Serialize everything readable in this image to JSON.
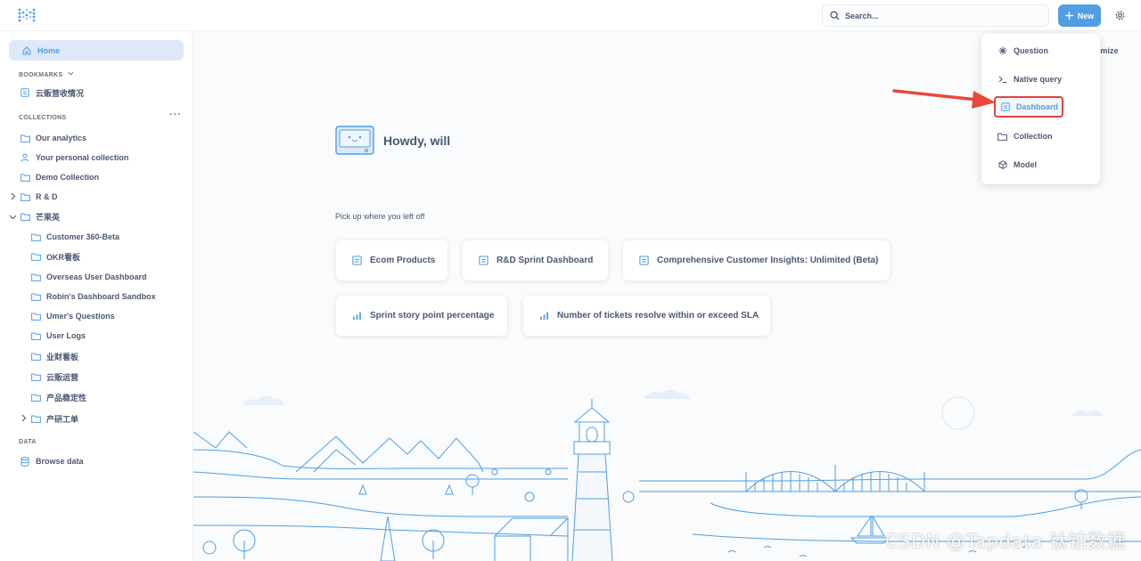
{
  "header": {
    "search_placeholder": "Search...",
    "new_label": "New"
  },
  "sidebar": {
    "home": "Home",
    "bookmarks_heading": "BOOKMARKS",
    "bookmarks": [
      "云贩营收情况"
    ],
    "collections_heading": "COLLECTIONS",
    "collections": [
      "Our analytics",
      "Your personal collection",
      "Demo Collection",
      "R & D",
      "芒果英"
    ],
    "sub_collections": [
      "Customer 360-Beta",
      "OKR看板",
      "Overseas User Dashboard",
      "Robin's Dashboard Sandbox",
      "Umer's Questions",
      "User Logs",
      "业财看板",
      "云贩运营",
      "产品稳定性",
      "产研工单"
    ],
    "data_heading": "DATA",
    "browse_data": "Browse data"
  },
  "main": {
    "greeting": "Howdy, will",
    "pickup_heading": "Pick up where you left off",
    "customize_partial": "omize",
    "recent_items": [
      {
        "label": "Ecom Products",
        "icon": "dashboard-icon"
      },
      {
        "label": "R&D Sprint Dashboard",
        "icon": "dashboard-icon"
      },
      {
        "label": "Comprehensive Customer Insights: Unlimited (Beta)",
        "icon": "dashboard-icon"
      },
      {
        "label": "Sprint story point percentage",
        "icon": "bar-chart-icon"
      },
      {
        "label": "Number of tickets resolve within or exceed SLA",
        "icon": "bar-chart-icon"
      }
    ]
  },
  "new_menu": {
    "items": [
      "Question",
      "Native query",
      "Dashboard",
      "Collection",
      "Model"
    ],
    "highlighted": "Dashboard"
  },
  "watermark": "CSDN @Tapdata 钛铂数据",
  "colors": {
    "brand": "#509ee3",
    "text": "#4c5773",
    "highlight_border": "#e04343",
    "annotation_arrow": "#e8483b"
  }
}
